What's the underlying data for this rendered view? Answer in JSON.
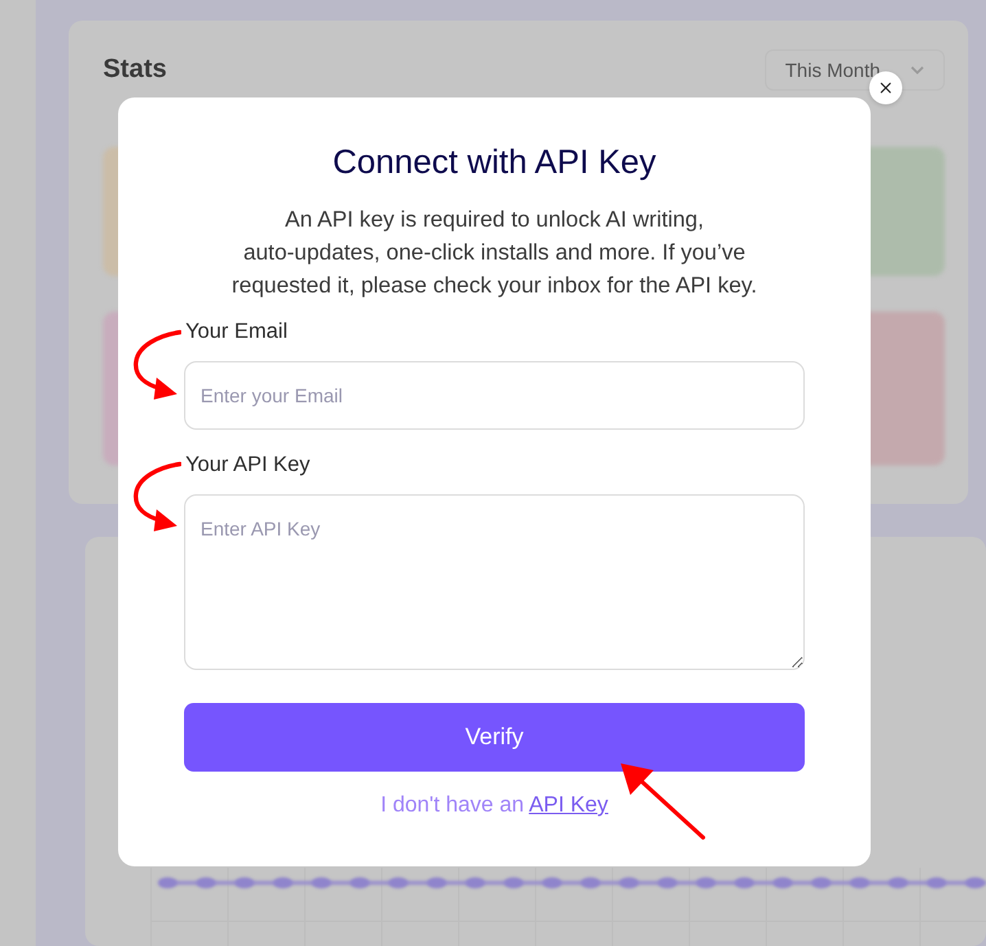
{
  "backdrop": {
    "title": "Stats",
    "period_select": "This Month"
  },
  "dialog": {
    "title": "Connect with API Key",
    "description": "An API key is required to unlock AI writing,\nauto-updates, one-click installs and more. If you’ve\nrequested it, please check your inbox for the API key.",
    "fields": [
      {
        "kind": "email",
        "label": "Your Email",
        "placeholder": "Enter your Email"
      },
      {
        "kind": "textarea",
        "label": "Your API Key",
        "placeholder": "Enter API Key"
      }
    ],
    "submit": "Verify",
    "footer": {
      "text": "I don't have an",
      "link": "API Key"
    }
  }
}
